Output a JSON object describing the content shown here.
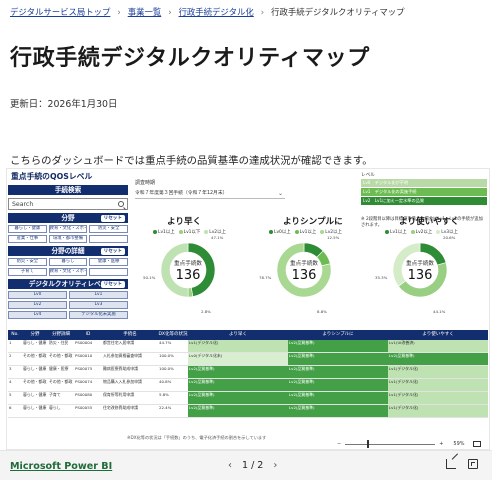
{
  "breadcrumb": {
    "items": [
      "デジタルサービス局トップ",
      "事業一覧",
      "行政手続デジタル化"
    ],
    "current": "行政手続デジタルクオリティマップ",
    "separator": "›"
  },
  "page": {
    "title": "行政手続デジタルクオリティマップ",
    "updated": "更新日：2026年1月30日",
    "intro": "こちらのダッシュボードでは重点手続の品質基準の達成状況が確認できます。"
  },
  "dashboard": {
    "left_panel": {
      "title": "重点手続のQOSレベル",
      "search_section": "手続検索",
      "search_placeholder": "Search",
      "field_section": "分野",
      "field_chips": [
        "暮らし・健康",
        "教育・文化・スポーツ",
        "防災・安全",
        "産業・仕事",
        "環境・都市整備",
        ""
      ],
      "reset_label": "リセット",
      "detail_section": "分野の詳細",
      "detail_chips": [
        "防災・安全",
        "暮らし",
        "健康・医療",
        "子育て",
        "教育・文化・スポーツ",
        ""
      ],
      "quality_section": "デジタルクオリティレベル",
      "quality_chips": [
        "Lv0",
        "Lv1",
        "Lv2",
        "Lv3",
        "Lv4",
        "デジタル化未実施"
      ]
    },
    "survey_label": "調査時期",
    "survey_value": "令和７年度第３回手続（令和７年12月末）",
    "legend_caption": "レベル",
    "legend": [
      {
        "label": "Lv0",
        "text": "デジタル化が不明",
        "color": "#b9d9a6"
      },
      {
        "label": "Lv1",
        "text": "デジタル化の実施手続",
        "color": "#6dbb53"
      },
      {
        "label": "Lv2",
        "text": "Lv1に加え一定水準の品質",
        "color": "#2f8b34"
      },
      {
        "label": "Lv3",
        "text": "Lv2に加え更に高い品質",
        "color": "#17622a"
      }
    ],
    "legend_note": "※ 2段階目以降は目標値を満たす場合はLv1、Lv2の手続が追加されます。",
    "donut_caption": "重点手続数",
    "donuts": [
      {
        "title": "より早く",
        "total": "136",
        "legend": [
          "Lv1以上",
          "Lv1以下",
          "Lv2以上"
        ],
        "slices": [
          {
            "label": "Lv1以上",
            "pct": "47.1%",
            "value": 0.471,
            "color": "#2e8b36"
          },
          {
            "label": "Lv1",
            "pct": "2.8%",
            "value": 0.028,
            "color": "#99cf82"
          },
          {
            "label": "Lv2",
            "pct": "50.1%",
            "value": 0.501,
            "color": "#bfe2b2"
          }
        ]
      },
      {
        "title": "よりシンプルに",
        "total": "136",
        "legend": [
          "Lv0以上",
          "Lv1以上",
          "Lv2以上"
        ],
        "slices": [
          {
            "label": "Lv0",
            "pct": "12.5%",
            "value": 0.125,
            "color": "#2e8b36"
          },
          {
            "label": "Lv1",
            "pct": "8.8%",
            "value": 0.088,
            "color": "#6dbb53"
          },
          {
            "label": "Lv2",
            "pct": "78.7%",
            "value": 0.787,
            "color": "#a9d892"
          }
        ]
      },
      {
        "title": "より使いやすく",
        "total": "136",
        "legend": [
          "Lv1以上",
          "Lv2以上",
          "Lv3以上"
        ],
        "slices": [
          {
            "label": "Lv3",
            "pct": "20.6%",
            "value": 0.206,
            "color": "#2e8b36"
          },
          {
            "label": "Lv2",
            "pct": "44.1%",
            "value": 0.441,
            "color": "#99cf82"
          },
          {
            "label": "Lv1",
            "pct": "35.3%",
            "value": 0.353,
            "color": "#d5ecc9"
          }
        ]
      }
    ],
    "table": {
      "headers": [
        "No.",
        "分野",
        "分野詳細",
        "ID",
        "手続名",
        "DX化等の状況",
        "より早く",
        "よりシンプルに",
        "より使いやすく"
      ],
      "rows": [
        [
          "1",
          "暮らし・健康",
          "防災・住民",
          "PS00004",
          "都営住宅入居申請",
          "44.7%",
          "Lv1(デジタル化)",
          "Lv2(品質基準)",
          "Lv1(UI改善済)"
        ],
        [
          "2",
          "その他・都政",
          "その他・都政",
          "PS00010",
          "入札参加資格審査申請",
          "100.0%",
          "Lv0(デジタル化未)",
          "Lv2(品質基準)",
          "Lv2(品質基準)"
        ],
        [
          "3",
          "暮らし・健康",
          "健康・医療",
          "PS00075",
          "難病医療費助成申請",
          "100.0%",
          "Lv2(品質基準)",
          "Lv2(品質基準)",
          "Lv1(デジタル化)"
        ],
        [
          "4",
          "その他・都政",
          "その他・都政",
          "PS00074",
          "物品購入入札参加申請",
          "40.8%",
          "Lv2(品質基準)",
          "Lv2(品質基準)",
          "Lv1(デジタル化)"
        ],
        [
          "5",
          "暮らし・健康",
          "子育て",
          "PS00080",
          "保育所等利用申請",
          "5.8%",
          "Lv2(品質基準)",
          "Lv2(品質基準)",
          "Lv1(デジタル化)"
        ],
        [
          "6",
          "暮らし・健康",
          "暮らし",
          "PS00055",
          "住宅改修費助成申請",
          "22.4%",
          "Lv2(品質基準)",
          "Lv2(品質基準)",
          "Lv1(デジタル化)"
        ]
      ],
      "note": "※DX化等の状況は「手続数」のうち、電子化済手続の割合を示しています"
    },
    "zoom": {
      "minus": "−",
      "plus": "+",
      "percent": "59%"
    }
  },
  "footer": {
    "brand": "Microsoft Power BI",
    "page_indicator": "1 / 2",
    "prev": "‹",
    "next": "›"
  }
}
